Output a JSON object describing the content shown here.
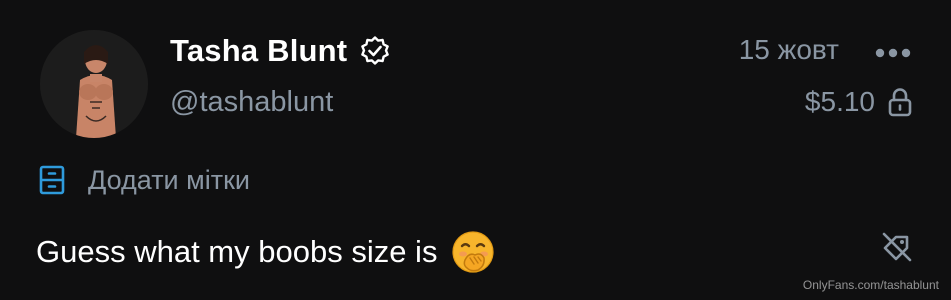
{
  "post": {
    "author": {
      "display_name": "Tasha Blunt",
      "username": "@tashablunt",
      "verified": true
    },
    "date": "15 жовт",
    "price": "$5.10",
    "tags_label": "Додати мітки",
    "caption": "Guess what my boobs size is",
    "caption_emoji": "face-with-hand-over-mouth"
  },
  "watermark": "OnlyFans.com/tashablunt",
  "colors": {
    "background": "#0f0f10",
    "primary_text": "#ffffff",
    "secondary_text": "#8a96a3",
    "accent_blue": "#2f9bdc"
  },
  "icons": {
    "verified": "verified-badge-icon",
    "more": "more-dots-icon",
    "lock": "lock-icon",
    "tag": "tag-list-icon",
    "no_tip": "no-tip-icon"
  }
}
